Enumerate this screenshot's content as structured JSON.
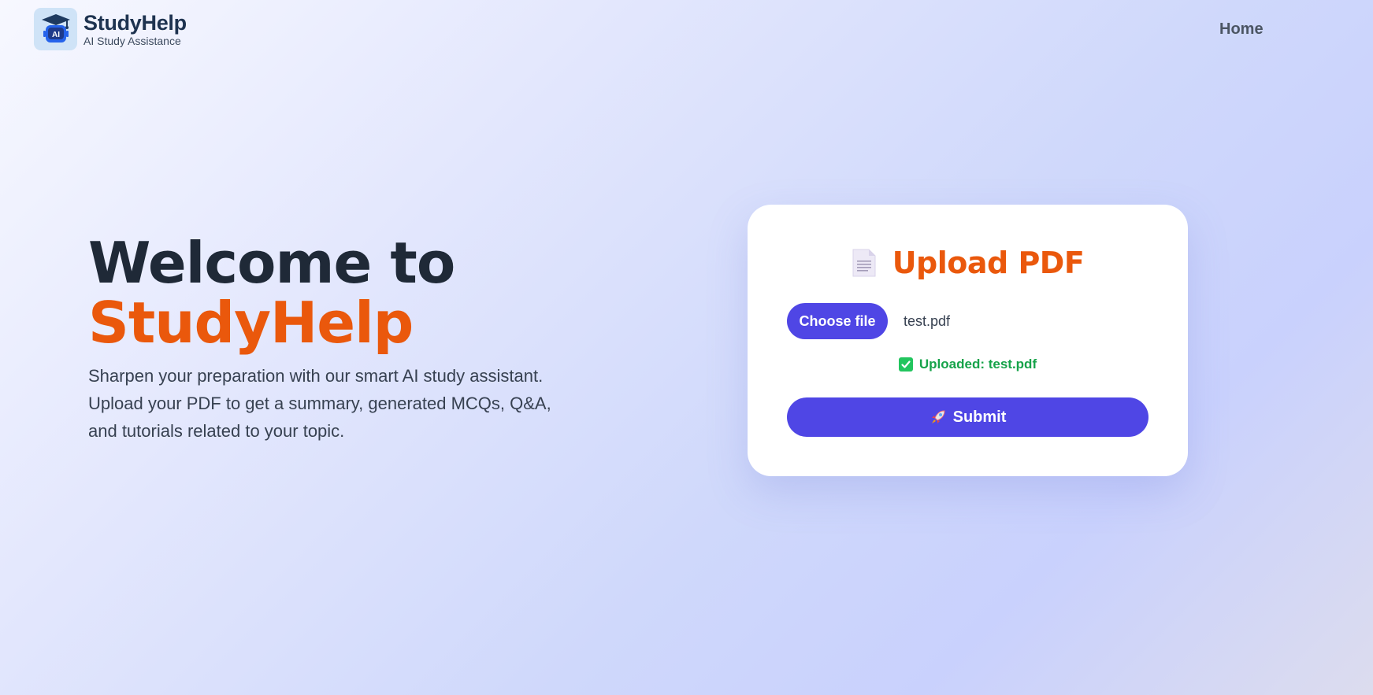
{
  "header": {
    "logo_title": "StudyHelp",
    "logo_subtitle": "AI Study Assistance",
    "logo_badge_text": "AI",
    "nav": {
      "home_label": "Home"
    }
  },
  "hero": {
    "title_line1": "Welcome to",
    "title_line2": "StudyHelp",
    "description": "Sharpen your preparation with our smart AI study assistant. Upload your PDF to get a summary, generated MCQs, Q&A, and tutorials related to your topic."
  },
  "upload_card": {
    "title": "Upload PDF",
    "title_icon": "document-icon",
    "choose_file_label": "Choose file",
    "selected_file": "test.pdf",
    "status_icon": "check-icon",
    "status_text": "Uploaded: test.pdf",
    "submit_icon": "rocket-icon",
    "submit_label": "Submit"
  },
  "colors": {
    "accent_orange": "#ea580c",
    "primary_button": "#4f46e5",
    "success_green": "#16a34a",
    "heading_dark": "#1f2937"
  }
}
